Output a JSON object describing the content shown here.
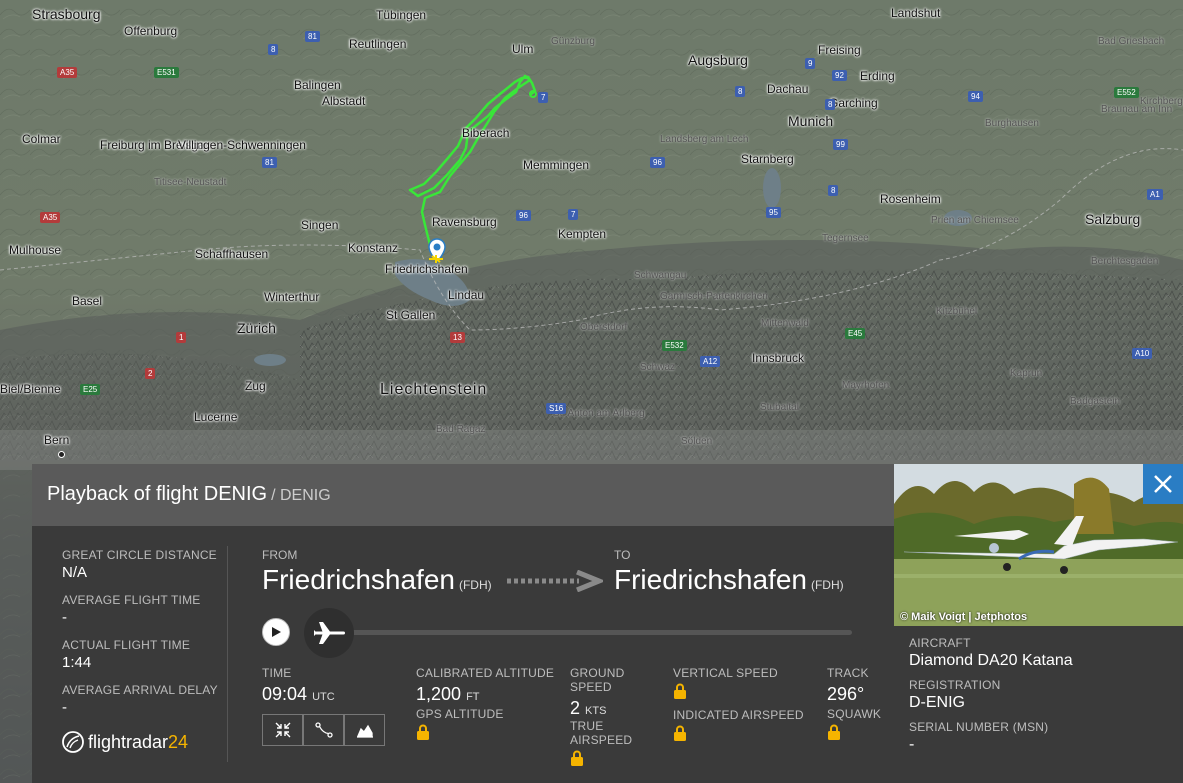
{
  "map": {
    "cities": [
      {
        "name": "Strasbourg",
        "cls": "big"
      },
      {
        "name": "Tübingen",
        "cls": ""
      },
      {
        "name": "Offenburg",
        "cls": ""
      },
      {
        "name": "Reutlingen",
        "cls": ""
      },
      {
        "name": "Ulm",
        "cls": ""
      },
      {
        "name": "Günzburg",
        "cls": "small"
      },
      {
        "name": "Augsburg",
        "cls": "big"
      },
      {
        "name": "Landshut",
        "cls": ""
      },
      {
        "name": "Freising",
        "cls": ""
      },
      {
        "name": "Bad Griesbach",
        "cls": "small"
      },
      {
        "name": "Erding",
        "cls": ""
      },
      {
        "name": "Balingen",
        "cls": ""
      },
      {
        "name": "Albstadt",
        "cls": ""
      },
      {
        "name": "Dachau",
        "cls": ""
      },
      {
        "name": "Garching",
        "cls": ""
      },
      {
        "name": "Kirchberg",
        "cls": "small"
      },
      {
        "name": "Braunau am Inn",
        "cls": "small"
      },
      {
        "name": "Colmar",
        "cls": ""
      },
      {
        "name": "Biberach",
        "cls": ""
      },
      {
        "name": "Munich",
        "cls": "big"
      },
      {
        "name": "Freiburg im Breisgau",
        "cls": ""
      },
      {
        "name": "Villingen-Schwenningen",
        "cls": ""
      },
      {
        "name": "Landsberg am Lech",
        "cls": "small"
      },
      {
        "name": "Burghausen",
        "cls": "small"
      },
      {
        "name": "Memmingen",
        "cls": ""
      },
      {
        "name": "Starnberg",
        "cls": ""
      },
      {
        "name": "Titisee-Neustadt",
        "cls": "small"
      },
      {
        "name": "Rosenheim",
        "cls": ""
      },
      {
        "name": "Singen",
        "cls": ""
      },
      {
        "name": "Ravensburg",
        "cls": ""
      },
      {
        "name": "Salzburg",
        "cls": "big"
      },
      {
        "name": "Prien am Chiemsee",
        "cls": "small"
      },
      {
        "name": "Kempten",
        "cls": ""
      },
      {
        "name": "Konstanz",
        "cls": ""
      },
      {
        "name": "Tegernsee",
        "cls": "small"
      },
      {
        "name": "Mulhouse",
        "cls": ""
      },
      {
        "name": "Schaffhausen",
        "cls": ""
      },
      {
        "name": "Friedrichshafen",
        "cls": ""
      },
      {
        "name": "Schwangau",
        "cls": "small"
      },
      {
        "name": "Berchtesgaden",
        "cls": "small"
      },
      {
        "name": "Lindau",
        "cls": ""
      },
      {
        "name": "Garmisch-Partenkirchen",
        "cls": "small"
      },
      {
        "name": "Basel",
        "cls": ""
      },
      {
        "name": "Winterthur",
        "cls": ""
      },
      {
        "name": "St Gallen",
        "cls": ""
      },
      {
        "name": "Oberstdorf",
        "cls": "small"
      },
      {
        "name": "Mittenwald",
        "cls": "small"
      },
      {
        "name": "Kitzbühel",
        "cls": "small"
      },
      {
        "name": "Zürich",
        "cls": "big"
      },
      {
        "name": "Innsbruck",
        "cls": ""
      },
      {
        "name": "Schwaz",
        "cls": "small"
      },
      {
        "name": "Zug",
        "cls": ""
      },
      {
        "name": "Liechtenstein",
        "cls": "xl"
      },
      {
        "name": "Kaprun",
        "cls": "small"
      },
      {
        "name": "Mayrhofen",
        "cls": "small"
      },
      {
        "name": "Lucerne",
        "cls": ""
      },
      {
        "name": "St. Anton am Arlberg",
        "cls": "small"
      },
      {
        "name": "Stubaital",
        "cls": "small"
      },
      {
        "name": "Bad Ragaz",
        "cls": "small"
      },
      {
        "name": "Bern",
        "cls": ""
      },
      {
        "name": "Sölden",
        "cls": "small"
      },
      {
        "name": "Badgastein",
        "cls": "small"
      },
      {
        "name": "Biel/Bienne",
        "cls": ""
      }
    ],
    "roads": [
      {
        "name": "81",
        "cls": ""
      },
      {
        "name": "8",
        "cls": ""
      },
      {
        "name": "A35",
        "cls": "red"
      },
      {
        "name": "E531",
        "cls": "green"
      },
      {
        "name": "7",
        "cls": ""
      },
      {
        "name": "8",
        "cls": ""
      },
      {
        "name": "9",
        "cls": ""
      },
      {
        "name": "92",
        "cls": ""
      },
      {
        "name": "8",
        "cls": ""
      },
      {
        "name": "94",
        "cls": ""
      },
      {
        "name": "E552",
        "cls": "green"
      },
      {
        "name": "81",
        "cls": ""
      },
      {
        "name": "96",
        "cls": ""
      },
      {
        "name": "99",
        "cls": ""
      },
      {
        "name": "8",
        "cls": ""
      },
      {
        "name": "A1",
        "cls": ""
      },
      {
        "name": "A35",
        "cls": "red"
      },
      {
        "name": "96",
        "cls": ""
      },
      {
        "name": "7",
        "cls": ""
      },
      {
        "name": "95",
        "cls": ""
      },
      {
        "name": "E532",
        "cls": "green"
      },
      {
        "name": "A12",
        "cls": ""
      },
      {
        "name": "E45",
        "cls": "green"
      },
      {
        "name": "A10",
        "cls": ""
      },
      {
        "name": "1",
        "cls": "red"
      },
      {
        "name": "13",
        "cls": "red"
      },
      {
        "name": "2",
        "cls": "red"
      },
      {
        "name": "E25",
        "cls": "green"
      },
      {
        "name": "S16",
        "cls": ""
      }
    ]
  },
  "panel": {
    "title": "Playback of flight DENIG",
    "subtitle": "/ DENIG",
    "left": [
      {
        "label": "GREAT CIRCLE DISTANCE",
        "value": "N/A"
      },
      {
        "label": "AVERAGE FLIGHT TIME",
        "value": "-"
      },
      {
        "label": "ACTUAL FLIGHT TIME",
        "value": "1:44"
      },
      {
        "label": "AVERAGE ARRIVAL DELAY",
        "value": "-"
      }
    ],
    "logo": {
      "main": "flightradar",
      "accent": "24"
    },
    "route": {
      "from_label": "FROM",
      "from_city": "Friedrichshafen",
      "from_code": "(FDH)",
      "to_label": "TO",
      "to_city": "Friedrichshafen",
      "to_code": "(FDH)"
    },
    "playback_progress": 0.0,
    "stats": {
      "time_label": "TIME",
      "time_value": "09:04",
      "time_unit": "UTC",
      "cal_alt_label": "CALIBRATED ALTITUDE",
      "cal_alt_value": "1,200",
      "cal_alt_unit": "FT",
      "gps_alt_label": "GPS ALTITUDE",
      "ground_speed_label_1": "GROUND",
      "ground_speed_label_2": "SPEED",
      "ground_speed_value": "2",
      "ground_speed_unit": "KTS",
      "true_airspeed_label_1": "TRUE",
      "true_airspeed_label_2": "AIRSPEED",
      "vertical_speed_label": "VERTICAL SPEED",
      "indicated_airspeed_label": "INDICATED AIRSPEED",
      "track_label": "TRACK",
      "track_value": "296°",
      "squawk_label": "SQUAWK"
    },
    "tools": [
      "collapse-icon",
      "route-icon",
      "chart-icon"
    ]
  },
  "aircraft": {
    "photo_credit": "© Maik Voigt | Jetphotos",
    "aircraft_label": "AIRCRAFT",
    "aircraft_value": "Diamond DA20 Katana",
    "registration_label": "REGISTRATION",
    "registration_value": "D-ENIG",
    "serial_label": "SERIAL NUMBER (MSN)",
    "serial_value": "-"
  },
  "colors": {
    "track": "#39e639",
    "panel": "#3a3a3a",
    "header": "#5a5a5a",
    "close": "#2a7dc4",
    "accent": "#f5b400"
  }
}
